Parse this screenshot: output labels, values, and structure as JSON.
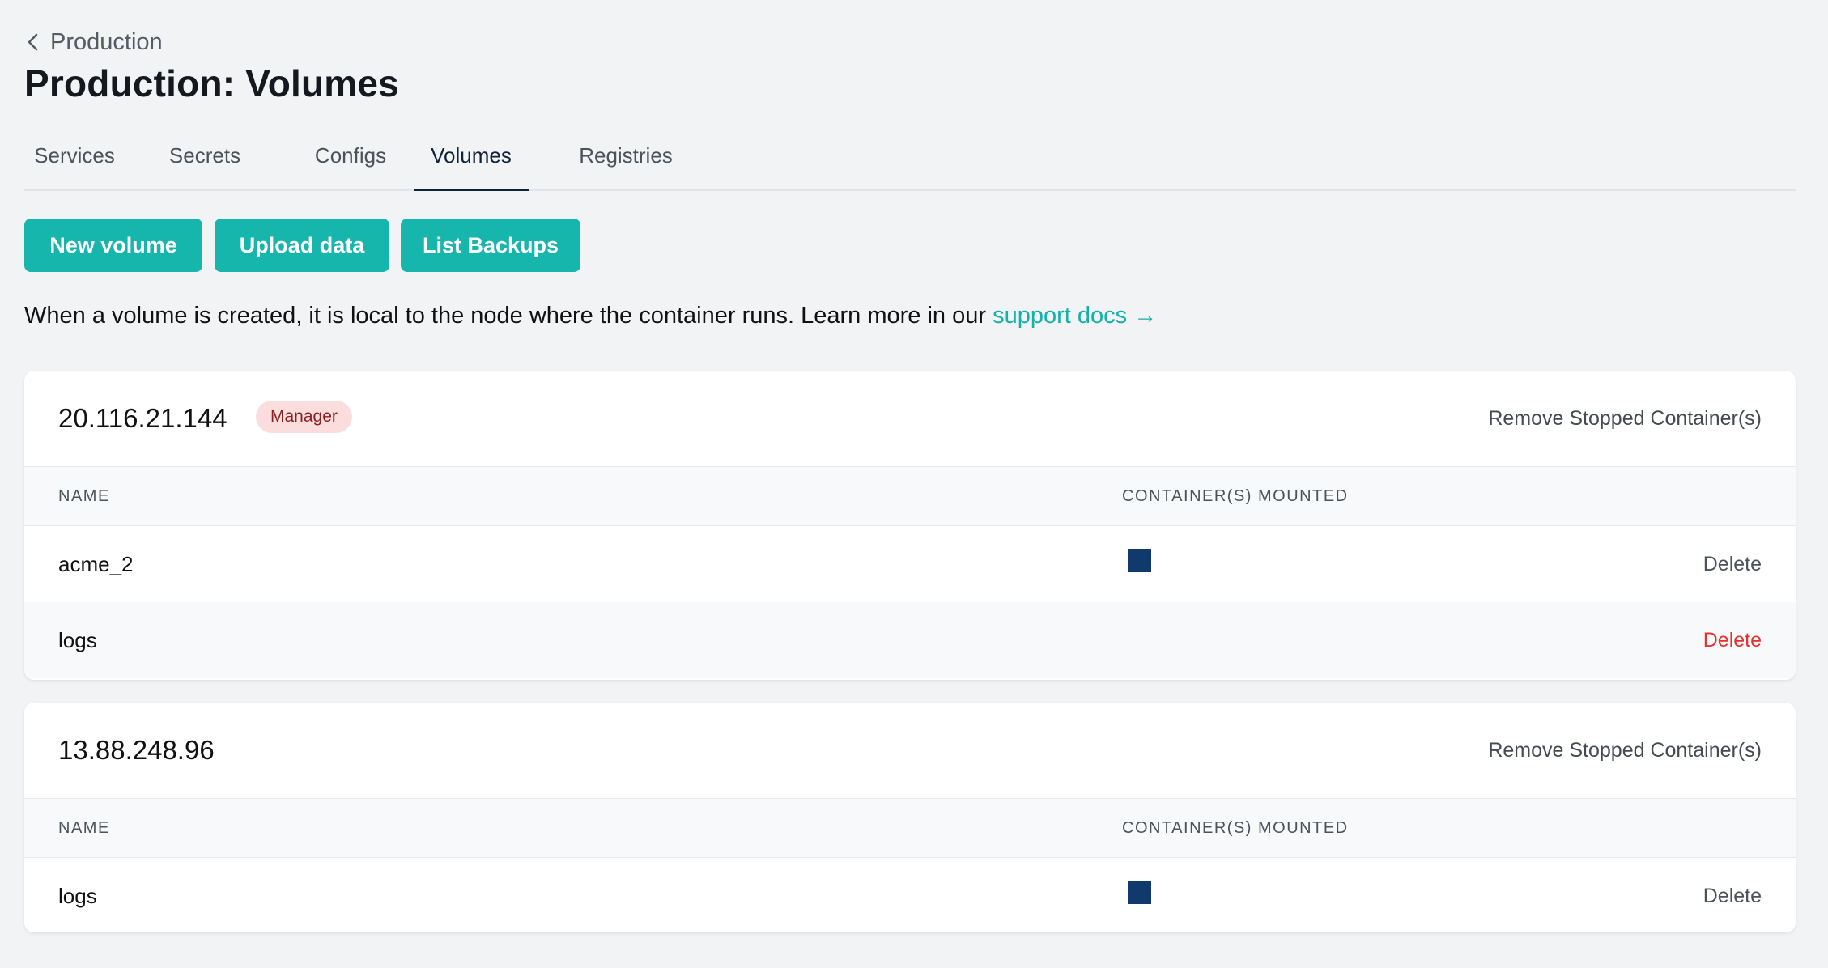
{
  "breadcrumb": {
    "label": "Production"
  },
  "page": {
    "title": "Production: Volumes"
  },
  "tabs": [
    {
      "label": "Services"
    },
    {
      "label": "Secrets"
    },
    {
      "label": "Configs"
    },
    {
      "label": "Volumes",
      "active": true
    },
    {
      "label": "Registries"
    }
  ],
  "actions": {
    "new_volume": "New volume",
    "upload_data": "Upload data",
    "list_backups": "List Backups"
  },
  "info": {
    "text": "When a volume is created, it is local to the node where the container runs. Learn more in our ",
    "link": "support docs →"
  },
  "colors": {
    "accent": "#16b6ac",
    "link": "#14b1a8",
    "danger": "#e5302f",
    "container": "#0f3a6b",
    "badge_bg": "#fbdddd"
  },
  "nodes": [
    {
      "host": "20.116.21.144",
      "badge": "Manager",
      "remove_label": "Remove Stopped Container(s)",
      "columns": {
        "name": "NAME",
        "mounted": "CONTAINER(S) MOUNTED"
      },
      "rows": [
        {
          "name": "acme_2",
          "has_container": true,
          "delete": "Delete"
        },
        {
          "name": "logs",
          "has_container": false,
          "delete": "Delete"
        }
      ]
    },
    {
      "host": "13.88.248.96",
      "remove_label": "Remove Stopped Container(s)",
      "columns": {
        "name": "NAME",
        "mounted": "CONTAINER(S) MOUNTED"
      },
      "rows": [
        {
          "name": "logs",
          "has_container": true,
          "delete": "Delete"
        }
      ]
    }
  ]
}
